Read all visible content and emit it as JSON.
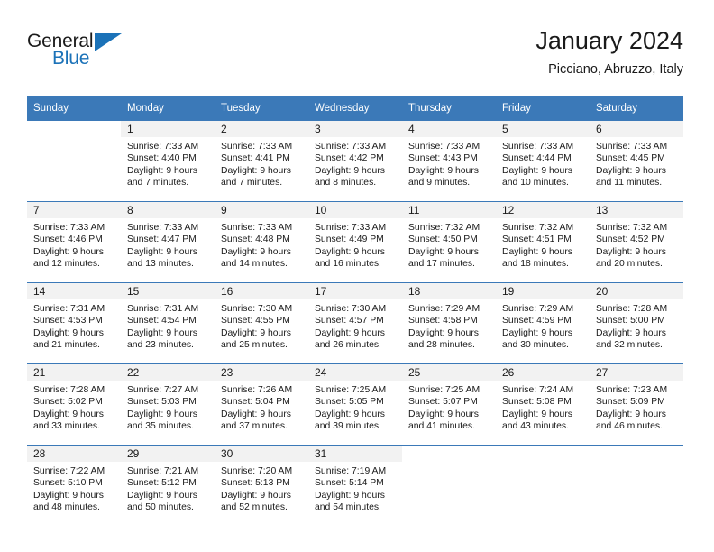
{
  "brand": {
    "name_part1": "General",
    "name_part2": "Blue",
    "triangle_icon": "triangle-icon"
  },
  "header": {
    "title": "January 2024",
    "subtitle": "Picciano, Abruzzo, Italy"
  },
  "colors": {
    "header_blue": "#3b79b8",
    "brand_blue": "#1b72b8",
    "daynum_bg": "#f2f2f2",
    "text": "#1a1a1a"
  },
  "calendar": {
    "weekday_headers": [
      "Sunday",
      "Monday",
      "Tuesday",
      "Wednesday",
      "Thursday",
      "Friday",
      "Saturday"
    ],
    "weeks": [
      [
        {
          "day": "",
          "sunrise": "",
          "sunset": "",
          "daylight_1": "",
          "daylight_2": ""
        },
        {
          "day": "1",
          "sunrise": "Sunrise: 7:33 AM",
          "sunset": "Sunset: 4:40 PM",
          "daylight_1": "Daylight: 9 hours",
          "daylight_2": "and 7 minutes."
        },
        {
          "day": "2",
          "sunrise": "Sunrise: 7:33 AM",
          "sunset": "Sunset: 4:41 PM",
          "daylight_1": "Daylight: 9 hours",
          "daylight_2": "and 7 minutes."
        },
        {
          "day": "3",
          "sunrise": "Sunrise: 7:33 AM",
          "sunset": "Sunset: 4:42 PM",
          "daylight_1": "Daylight: 9 hours",
          "daylight_2": "and 8 minutes."
        },
        {
          "day": "4",
          "sunrise": "Sunrise: 7:33 AM",
          "sunset": "Sunset: 4:43 PM",
          "daylight_1": "Daylight: 9 hours",
          "daylight_2": "and 9 minutes."
        },
        {
          "day": "5",
          "sunrise": "Sunrise: 7:33 AM",
          "sunset": "Sunset: 4:44 PM",
          "daylight_1": "Daylight: 9 hours",
          "daylight_2": "and 10 minutes."
        },
        {
          "day": "6",
          "sunrise": "Sunrise: 7:33 AM",
          "sunset": "Sunset: 4:45 PM",
          "daylight_1": "Daylight: 9 hours",
          "daylight_2": "and 11 minutes."
        }
      ],
      [
        {
          "day": "7",
          "sunrise": "Sunrise: 7:33 AM",
          "sunset": "Sunset: 4:46 PM",
          "daylight_1": "Daylight: 9 hours",
          "daylight_2": "and 12 minutes."
        },
        {
          "day": "8",
          "sunrise": "Sunrise: 7:33 AM",
          "sunset": "Sunset: 4:47 PM",
          "daylight_1": "Daylight: 9 hours",
          "daylight_2": "and 13 minutes."
        },
        {
          "day": "9",
          "sunrise": "Sunrise: 7:33 AM",
          "sunset": "Sunset: 4:48 PM",
          "daylight_1": "Daylight: 9 hours",
          "daylight_2": "and 14 minutes."
        },
        {
          "day": "10",
          "sunrise": "Sunrise: 7:33 AM",
          "sunset": "Sunset: 4:49 PM",
          "daylight_1": "Daylight: 9 hours",
          "daylight_2": "and 16 minutes."
        },
        {
          "day": "11",
          "sunrise": "Sunrise: 7:32 AM",
          "sunset": "Sunset: 4:50 PM",
          "daylight_1": "Daylight: 9 hours",
          "daylight_2": "and 17 minutes."
        },
        {
          "day": "12",
          "sunrise": "Sunrise: 7:32 AM",
          "sunset": "Sunset: 4:51 PM",
          "daylight_1": "Daylight: 9 hours",
          "daylight_2": "and 18 minutes."
        },
        {
          "day": "13",
          "sunrise": "Sunrise: 7:32 AM",
          "sunset": "Sunset: 4:52 PM",
          "daylight_1": "Daylight: 9 hours",
          "daylight_2": "and 20 minutes."
        }
      ],
      [
        {
          "day": "14",
          "sunrise": "Sunrise: 7:31 AM",
          "sunset": "Sunset: 4:53 PM",
          "daylight_1": "Daylight: 9 hours",
          "daylight_2": "and 21 minutes."
        },
        {
          "day": "15",
          "sunrise": "Sunrise: 7:31 AM",
          "sunset": "Sunset: 4:54 PM",
          "daylight_1": "Daylight: 9 hours",
          "daylight_2": "and 23 minutes."
        },
        {
          "day": "16",
          "sunrise": "Sunrise: 7:30 AM",
          "sunset": "Sunset: 4:55 PM",
          "daylight_1": "Daylight: 9 hours",
          "daylight_2": "and 25 minutes."
        },
        {
          "day": "17",
          "sunrise": "Sunrise: 7:30 AM",
          "sunset": "Sunset: 4:57 PM",
          "daylight_1": "Daylight: 9 hours",
          "daylight_2": "and 26 minutes."
        },
        {
          "day": "18",
          "sunrise": "Sunrise: 7:29 AM",
          "sunset": "Sunset: 4:58 PM",
          "daylight_1": "Daylight: 9 hours",
          "daylight_2": "and 28 minutes."
        },
        {
          "day": "19",
          "sunrise": "Sunrise: 7:29 AM",
          "sunset": "Sunset: 4:59 PM",
          "daylight_1": "Daylight: 9 hours",
          "daylight_2": "and 30 minutes."
        },
        {
          "day": "20",
          "sunrise": "Sunrise: 7:28 AM",
          "sunset": "Sunset: 5:00 PM",
          "daylight_1": "Daylight: 9 hours",
          "daylight_2": "and 32 minutes."
        }
      ],
      [
        {
          "day": "21",
          "sunrise": "Sunrise: 7:28 AM",
          "sunset": "Sunset: 5:02 PM",
          "daylight_1": "Daylight: 9 hours",
          "daylight_2": "and 33 minutes."
        },
        {
          "day": "22",
          "sunrise": "Sunrise: 7:27 AM",
          "sunset": "Sunset: 5:03 PM",
          "daylight_1": "Daylight: 9 hours",
          "daylight_2": "and 35 minutes."
        },
        {
          "day": "23",
          "sunrise": "Sunrise: 7:26 AM",
          "sunset": "Sunset: 5:04 PM",
          "daylight_1": "Daylight: 9 hours",
          "daylight_2": "and 37 minutes."
        },
        {
          "day": "24",
          "sunrise": "Sunrise: 7:25 AM",
          "sunset": "Sunset: 5:05 PM",
          "daylight_1": "Daylight: 9 hours",
          "daylight_2": "and 39 minutes."
        },
        {
          "day": "25",
          "sunrise": "Sunrise: 7:25 AM",
          "sunset": "Sunset: 5:07 PM",
          "daylight_1": "Daylight: 9 hours",
          "daylight_2": "and 41 minutes."
        },
        {
          "day": "26",
          "sunrise": "Sunrise: 7:24 AM",
          "sunset": "Sunset: 5:08 PM",
          "daylight_1": "Daylight: 9 hours",
          "daylight_2": "and 43 minutes."
        },
        {
          "day": "27",
          "sunrise": "Sunrise: 7:23 AM",
          "sunset": "Sunset: 5:09 PM",
          "daylight_1": "Daylight: 9 hours",
          "daylight_2": "and 46 minutes."
        }
      ],
      [
        {
          "day": "28",
          "sunrise": "Sunrise: 7:22 AM",
          "sunset": "Sunset: 5:10 PM",
          "daylight_1": "Daylight: 9 hours",
          "daylight_2": "and 48 minutes."
        },
        {
          "day": "29",
          "sunrise": "Sunrise: 7:21 AM",
          "sunset": "Sunset: 5:12 PM",
          "daylight_1": "Daylight: 9 hours",
          "daylight_2": "and 50 minutes."
        },
        {
          "day": "30",
          "sunrise": "Sunrise: 7:20 AM",
          "sunset": "Sunset: 5:13 PM",
          "daylight_1": "Daylight: 9 hours",
          "daylight_2": "and 52 minutes."
        },
        {
          "day": "31",
          "sunrise": "Sunrise: 7:19 AM",
          "sunset": "Sunset: 5:14 PM",
          "daylight_1": "Daylight: 9 hours",
          "daylight_2": "and 54 minutes."
        },
        {
          "day": "",
          "sunrise": "",
          "sunset": "",
          "daylight_1": "",
          "daylight_2": ""
        },
        {
          "day": "",
          "sunrise": "",
          "sunset": "",
          "daylight_1": "",
          "daylight_2": ""
        },
        {
          "day": "",
          "sunrise": "",
          "sunset": "",
          "daylight_1": "",
          "daylight_2": ""
        }
      ]
    ]
  }
}
